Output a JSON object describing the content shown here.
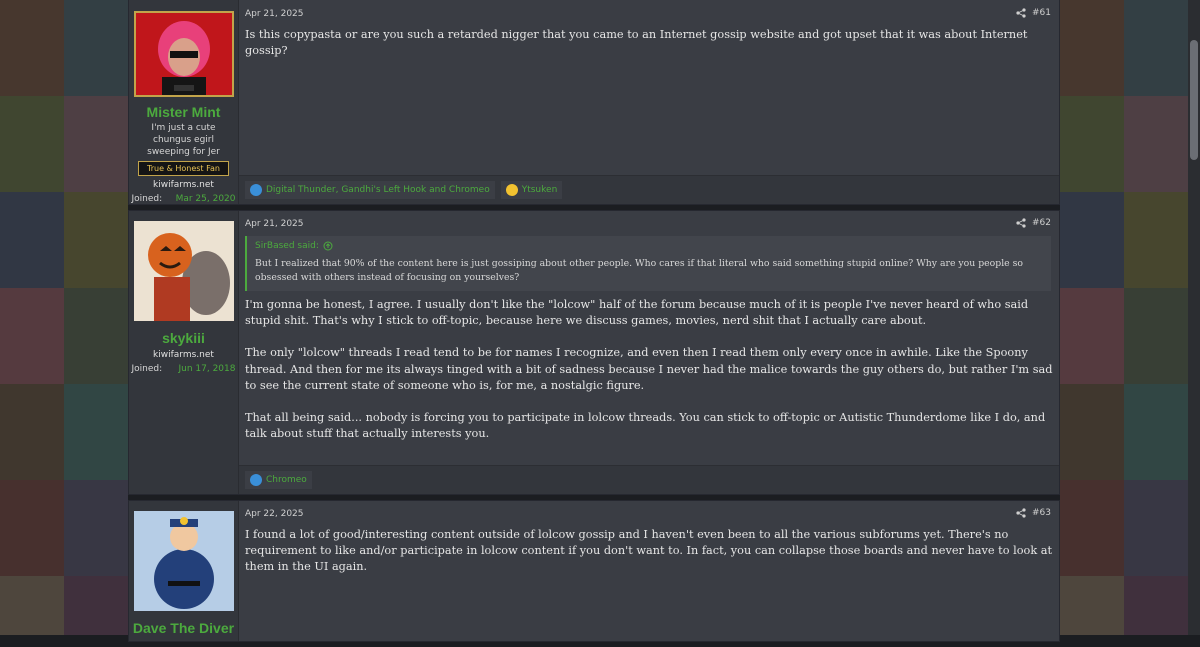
{
  "posts": [
    {
      "date": "Apr 21, 2025",
      "number": "#61",
      "user": {
        "name": "Mister Mint",
        "title": "I'm just a cute chungus egirl sweeping for Jer",
        "banner": "True & Honest Fan",
        "site": "kiwifarms.net",
        "joined_label": "Joined:",
        "joined_date": "Mar 25, 2020"
      },
      "body": [
        "Is this copypasta or are you such a retarded nigger that you came to an Internet gossip website and got upset that it was about Internet gossip?"
      ],
      "reactions": [
        {
          "text": "Digital Thunder, Gandhi's Left Hook and Chromeo",
          "icon": "thumbs-up-icon"
        },
        {
          "text": "Ytsuken",
          "icon": "thinking-face-icon"
        }
      ]
    },
    {
      "date": "Apr 21, 2025",
      "number": "#62",
      "user": {
        "name": "skykiii",
        "site": "kiwifarms.net",
        "joined_label": "Joined:",
        "joined_date": "Jun 17, 2018"
      },
      "quote": {
        "author": "SirBased said:",
        "text": "But I realized that 90% of the content here is just gossiping about other people. Who cares if that literal who said something stupid online? Why are you people so obsessed with others instead of focusing on yourselves?"
      },
      "body": [
        "I'm gonna be honest, I agree. I usually don't like the \"lolcow\" half of the forum because much of it is people I've never heard of who said stupid shit. That's why I stick to off-topic, because here we discuss games, movies, nerd shit that I actually care about.",
        "The only \"lolcow\" threads I read tend to be for names I recognize, and even then I read them only every once in awhile. Like the Spoony thread. And then for me its always tinged with a bit of sadness because I never had the malice towards the guy others do, but rather I'm sad to see the current state of someone who is, for me, a nostalgic figure.",
        "That all being said... nobody is forcing you to participate in lolcow threads. You can stick to off-topic or Autistic Thunderdome like I do, and talk about stuff that actually interests you."
      ],
      "reactions": [
        {
          "text": "Chromeo",
          "icon": "thumbs-up-icon"
        }
      ]
    },
    {
      "date": "Apr 22, 2025",
      "number": "#63",
      "user": {
        "name": "Dave The Diver"
      },
      "body": [
        "I found a lot of good/interesting content outside of lolcow gossip and I haven't even been to all the various subforums yet. There's no requirement to like and/or participate in lolcow content if you don't want to. In fact, you can collapse those boards and never have to look at them in the UI again."
      ]
    }
  ],
  "colors": {
    "accent": "#4caa3e",
    "post_bg": "#3a3d44",
    "user_bg": "#33363c",
    "banner_border": "#c2a44a"
  }
}
